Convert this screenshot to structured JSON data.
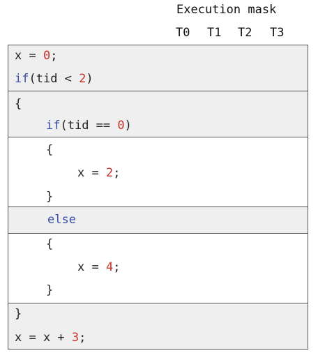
{
  "header": {
    "title": "Execution mask",
    "threads": [
      "T0",
      "T1",
      "T2",
      "T3"
    ]
  },
  "code": {
    "line1": {
      "a": "x = ",
      "n": "0",
      "b": ";"
    },
    "line2": {
      "kw": "if",
      "a": "(tid < ",
      "n": "2",
      "b": ")"
    },
    "line3": "{",
    "line4": {
      "kw": "if",
      "a": "(tid == ",
      "n": "0",
      "b": ")"
    },
    "line5": "{",
    "line6": {
      "a": "x = ",
      "n": "2",
      "b": ";"
    },
    "line7": "}",
    "line8": {
      "kw": "else"
    },
    "line9": "{",
    "line10": {
      "a": "x = ",
      "n": "4",
      "b": ";"
    },
    "line11": "}",
    "line12": "}",
    "line13": {
      "a": "x = x + ",
      "n": "3",
      "b": ";"
    }
  },
  "colors": {
    "keyword": "#3a4fa6",
    "number": "#c6332b",
    "block_fill": "#efefef",
    "border": "#555555"
  }
}
